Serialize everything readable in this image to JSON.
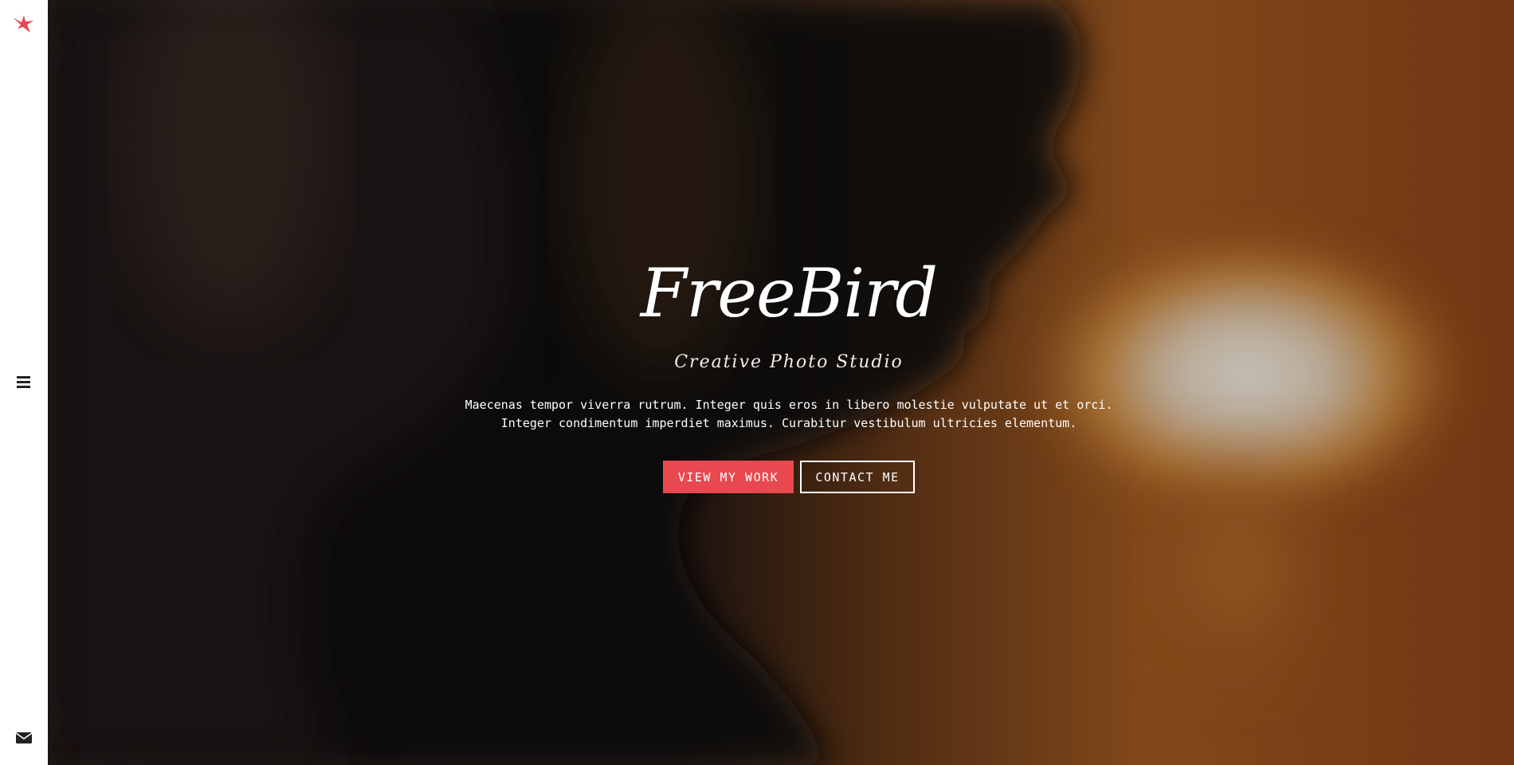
{
  "site": {
    "brand_color": "#e8484f",
    "logo_icon": "bird-icon"
  },
  "sidebar": {
    "menu_icon": "hamburger-menu-icon",
    "contact_icon": "envelope-icon"
  },
  "hero": {
    "title": "FreeBird",
    "subtitle": "Creative Photo Studio",
    "description_line1": "Maecenas tempor viverra rutrum. Integer quis eros in libero molestie vulputate ut et orci.",
    "description_line2": "Integer condimentum imperdiet maximus. Curabitur vestibulum ultricies elementum.",
    "primary_button": "VIEW MY WORK",
    "secondary_button": "CONTACT ME"
  }
}
